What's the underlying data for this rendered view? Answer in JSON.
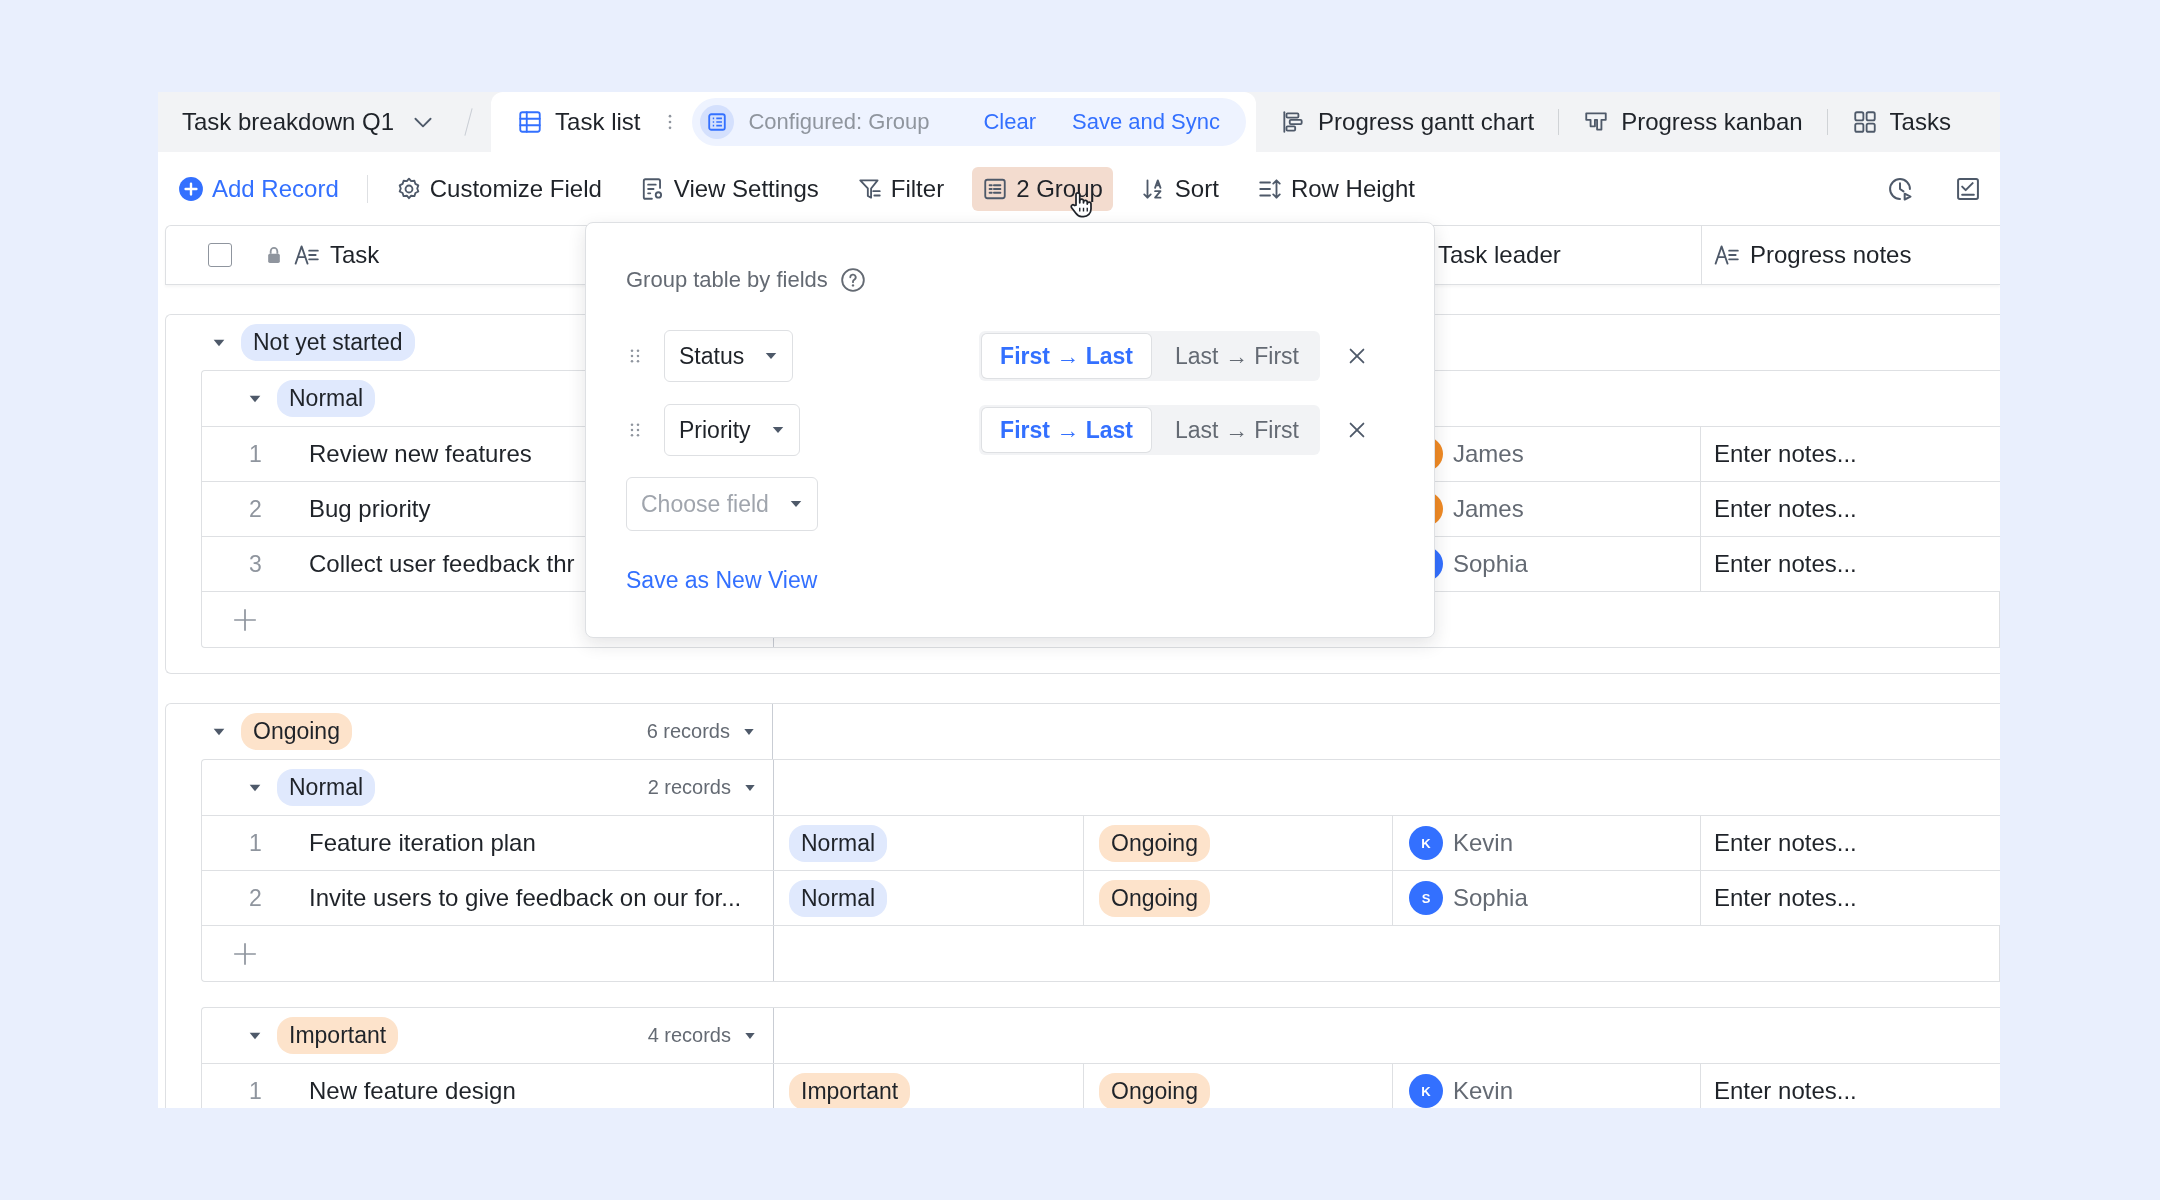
{
  "tab_bar": {
    "doc_title": "Task breakdown Q1",
    "views": [
      {
        "label": "Task list",
        "selected": true
      },
      {
        "label": "Progress gantt chart",
        "selected": false
      },
      {
        "label": "Progress kanban",
        "selected": false
      },
      {
        "label": "Tasks",
        "selected": false
      }
    ],
    "configured": {
      "label": "Configured: Group",
      "actions": [
        "Clear",
        "Save and Sync"
      ]
    }
  },
  "toolbar": {
    "items": [
      {
        "label": "Add Record",
        "kind": "primary",
        "active": false
      },
      {
        "label": "Customize Field",
        "kind": "tool",
        "active": false
      },
      {
        "label": "View Settings",
        "kind": "tool",
        "active": false
      },
      {
        "label": "Filter",
        "kind": "tool",
        "active": false
      },
      {
        "label": "2 Group",
        "kind": "tool",
        "active": true
      },
      {
        "label": "Sort",
        "kind": "tool",
        "active": false
      },
      {
        "label": "Row Height",
        "kind": "tool",
        "active": false
      }
    ]
  },
  "table": {
    "header": {
      "select_all_checked": false,
      "task": "Task",
      "task_leader": "Task leader",
      "progress_notes": "Progress notes"
    },
    "groups": [
      {
        "tag": "Not yet started",
        "color": "#e0e9fd",
        "expanded": true,
        "subgroups": [
          {
            "tag": "Normal",
            "color": "#e0e9fd",
            "expanded": true,
            "add_row": true,
            "rows": [
              {
                "number": "1",
                "task": "Review new features",
                "leader": {
                  "name": "James",
                  "color": "#f08a24"
                },
                "notes": "Enter notes..."
              },
              {
                "number": "2",
                "task": "Bug priority",
                "leader": {
                  "name": "James",
                  "color": "#f08a24"
                },
                "notes": "Enter notes..."
              },
              {
                "number": "3",
                "task": "Collect user feedback thr",
                "leader": {
                  "name": "Sophia",
                  "color": "#3370ff"
                },
                "notes": "Enter notes..."
              }
            ]
          }
        ]
      },
      {
        "tag": "Ongoing",
        "color": "#fde3cb",
        "expanded": true,
        "count": "6 records",
        "subgroups": [
          {
            "tag": "Normal",
            "color": "#e0e9fd",
            "expanded": true,
            "count": "2 records",
            "add_row": true,
            "rows": [
              {
                "number": "1",
                "task": "Feature iteration plan",
                "priority": {
                  "label": "Normal",
                  "color": "#e0e9fd"
                },
                "status": {
                  "label": "Ongoing",
                  "color": "#fde3cb"
                },
                "leader": {
                  "initial": "K",
                  "name": "Kevin",
                  "color": "#3370ff"
                },
                "notes": "Enter notes..."
              },
              {
                "number": "2",
                "task": "Invite users to give feedback on our for...",
                "priority": {
                  "label": "Normal",
                  "color": "#e0e9fd"
                },
                "status": {
                  "label": "Ongoing",
                  "color": "#fde3cb"
                },
                "leader": {
                  "initial": "S",
                  "name": "Sophia",
                  "color": "#3370ff"
                },
                "notes": "Enter notes..."
              }
            ]
          },
          {
            "tag": "Important",
            "color": "#fde3cb",
            "expanded": true,
            "count": "4 records",
            "rows": [
              {
                "number": "1",
                "task": "New feature design",
                "priority": {
                  "label": "Important",
                  "color": "#fde3cb"
                },
                "status": {
                  "label": "Ongoing",
                  "color": "#fde3cb"
                },
                "leader": {
                  "initial": "K",
                  "name": "Kevin",
                  "color": "#3370ff"
                },
                "notes": "Enter notes..."
              }
            ]
          }
        ]
      }
    ]
  },
  "group_popup": {
    "title": "Group table by fields",
    "fields": [
      {
        "field": "Status",
        "orders": [
          {
            "label": "First → Last",
            "selected": true
          },
          {
            "label": "Last → First",
            "selected": false
          }
        ]
      },
      {
        "field": "Priority",
        "orders": [
          {
            "label": "First → Last",
            "selected": true
          },
          {
            "label": "Last → First",
            "selected": false
          }
        ]
      }
    ],
    "choose_field": {
      "placeholder": "Choose field"
    },
    "save_link": "Save as New View"
  }
}
